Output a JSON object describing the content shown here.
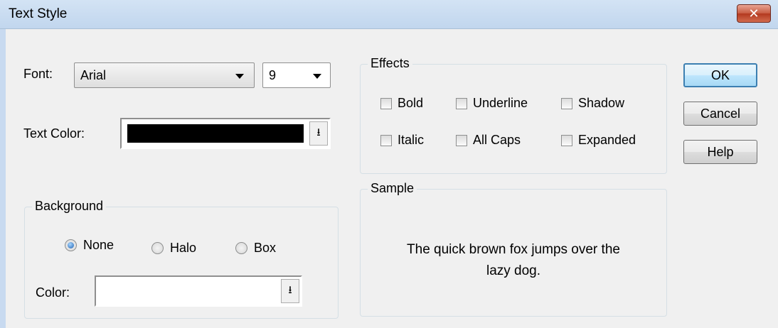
{
  "window": {
    "title": "Text Style",
    "close_glyph": "✕"
  },
  "font": {
    "label": "Font:",
    "value": "Arial",
    "size_value": "9"
  },
  "text_color": {
    "label": "Text Color:",
    "swatch_color": "#000000",
    "button_glyph": "⭳"
  },
  "background": {
    "legend": "Background",
    "options": [
      "None",
      "Halo",
      "Box"
    ],
    "selected": "None",
    "color_label": "Color:",
    "color_value": "#ffffff",
    "button_glyph": "⭳"
  },
  "effects": {
    "legend": "Effects",
    "checkboxes": [
      "Bold",
      "Underline",
      "Shadow",
      "Italic",
      "All Caps",
      "Expanded"
    ],
    "checked": []
  },
  "sample": {
    "legend": "Sample",
    "text_line1": "The quick brown fox jumps over the",
    "text_line2": "lazy dog."
  },
  "buttons": {
    "ok": "OK",
    "cancel": "Cancel",
    "help": "Help"
  }
}
